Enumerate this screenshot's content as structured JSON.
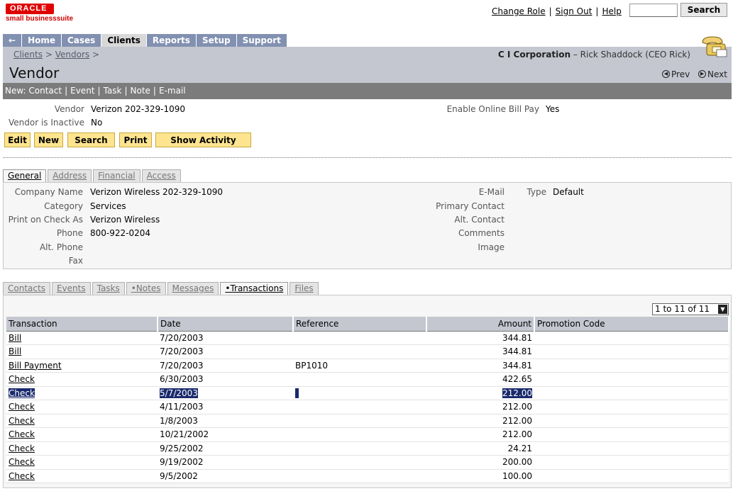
{
  "brand": {
    "oracle": "ORACLE",
    "suite": "small businesssuite"
  },
  "toplinks": {
    "change_role": "Change Role",
    "sign_out": "Sign Out",
    "help": "Help",
    "sep": "|",
    "search_value": "",
    "search_button": "Search"
  },
  "nav": {
    "back": "←",
    "tabs": [
      "Home",
      "Cases",
      "Clients",
      "Reports",
      "Setup",
      "Support"
    ],
    "active": "Clients"
  },
  "breadcrumb": {
    "item1": "Clients",
    "item2": "Vendors",
    "sep": ">"
  },
  "company": {
    "name": "C I Corporation",
    "user": "– Rick Shaddock (CEO Rick)"
  },
  "page_title": "Vendor",
  "prevnext": {
    "prev": "Prev",
    "next": "Next"
  },
  "newbar": {
    "label": "New:",
    "items": [
      "Contact",
      "Event",
      "Task",
      "Note",
      "E-mail"
    ]
  },
  "vendor": {
    "vendor_label": "Vendor",
    "vendor_value": "Verizon 202-329-1090",
    "inactive_label": "Vendor is Inactive",
    "inactive_value": "No",
    "billpay_label": "Enable Online Bill Pay",
    "billpay_value": "Yes"
  },
  "actions": [
    "Edit",
    "New",
    "Search",
    "Print",
    "Show Activity"
  ],
  "general_tabs": [
    "General",
    "Address",
    "Financial",
    "Access"
  ],
  "general": {
    "left": [
      {
        "label": "Company Name",
        "value": "Verizon Wireless 202-329-1090"
      },
      {
        "label": "Category",
        "value": "Services"
      },
      {
        "label": "Print on Check As",
        "value": "Verizon Wireless"
      },
      {
        "label": "Phone",
        "value": "800-922-0204"
      },
      {
        "label": "Alt. Phone",
        "value": ""
      },
      {
        "label": "Fax",
        "value": ""
      }
    ],
    "right": [
      {
        "label": "E-Mail",
        "value": ""
      },
      {
        "label": "Primary Contact",
        "value": ""
      },
      {
        "label": "Alt. Contact",
        "value": ""
      },
      {
        "label": "Comments",
        "value": ""
      },
      {
        "label": "Image",
        "value": ""
      }
    ],
    "type_label": "Type",
    "type_value": "Default"
  },
  "sub_tabs": [
    "Contacts",
    "Events",
    "Tasks",
    "•Notes",
    "Messages",
    "•Transactions",
    "Files"
  ],
  "pager": "1 to 11 of 11",
  "transactions": {
    "headers": [
      "Transaction",
      "Date",
      "Reference",
      "Amount",
      "Promotion Code"
    ],
    "rows": [
      {
        "transaction": "Bill",
        "date": "7/20/2003",
        "reference": "",
        "amount": "344.81",
        "promo": ""
      },
      {
        "transaction": "Bill",
        "date": "7/20/2003",
        "reference": "",
        "amount": "344.81",
        "promo": ""
      },
      {
        "transaction": "Bill Payment",
        "date": "7/20/2003",
        "reference": "BP1010",
        "amount": "344.81",
        "promo": ""
      },
      {
        "transaction": "Check",
        "date": "6/30/2003",
        "reference": "",
        "amount": "422.65",
        "promo": ""
      },
      {
        "transaction": "Check",
        "date": "5/7/2003",
        "reference": "",
        "amount": "212.00",
        "promo": ""
      },
      {
        "transaction": "Check",
        "date": "4/11/2003",
        "reference": "",
        "amount": "212.00",
        "promo": ""
      },
      {
        "transaction": "Check",
        "date": "1/8/2003",
        "reference": "",
        "amount": "212.00",
        "promo": ""
      },
      {
        "transaction": "Check",
        "date": "10/21/2002",
        "reference": "",
        "amount": "212.00",
        "promo": ""
      },
      {
        "transaction": "Check",
        "date": "9/25/2002",
        "reference": "",
        "amount": "24.21",
        "promo": ""
      },
      {
        "transaction": "Check",
        "date": "9/19/2002",
        "reference": "",
        "amount": "200.00",
        "promo": ""
      },
      {
        "transaction": "Check",
        "date": "9/5/2002",
        "reference": "",
        "amount": "100.00",
        "promo": ""
      }
    ]
  }
}
